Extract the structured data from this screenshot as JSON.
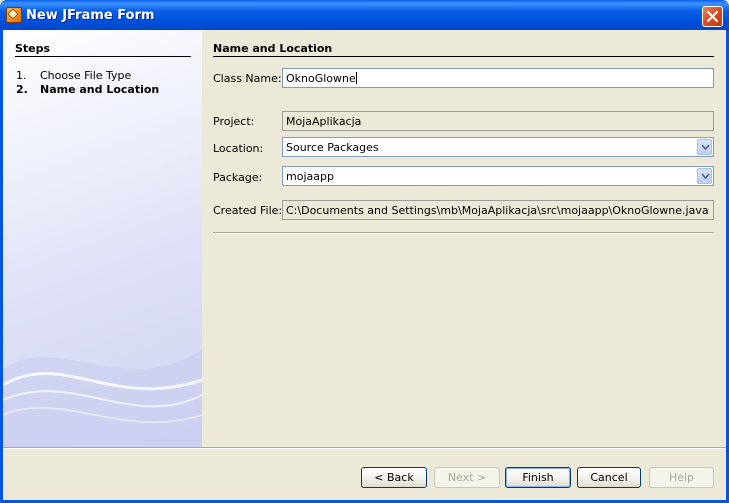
{
  "window": {
    "title": "New JFrame Form"
  },
  "steps": {
    "heading": "Steps",
    "items": [
      {
        "number": "1.",
        "label": "Choose File Type",
        "current": false
      },
      {
        "number": "2.",
        "label": "Name and Location",
        "current": true
      }
    ]
  },
  "form": {
    "heading": "Name and Location",
    "class_name": {
      "label": "Class Name:",
      "value": "OknoGlowne"
    },
    "project": {
      "label": "Project:",
      "value": "MojaAplikacja"
    },
    "location": {
      "label": "Location:",
      "value": "Source Packages"
    },
    "package": {
      "label": "Package:",
      "value": "mojaapp"
    },
    "created_file": {
      "label": "Created File:",
      "value": "C:\\Documents and Settings\\mb\\MojaAplikacja\\src\\mojaapp\\OknoGlowne.java"
    }
  },
  "buttons": {
    "back": "< Back",
    "next": "Next >",
    "finish": "Finish",
    "cancel": "Cancel",
    "help": "Help"
  },
  "icons": {
    "app": "java-form-icon",
    "close": "close-icon",
    "dropdown": "chevron-down-icon"
  }
}
